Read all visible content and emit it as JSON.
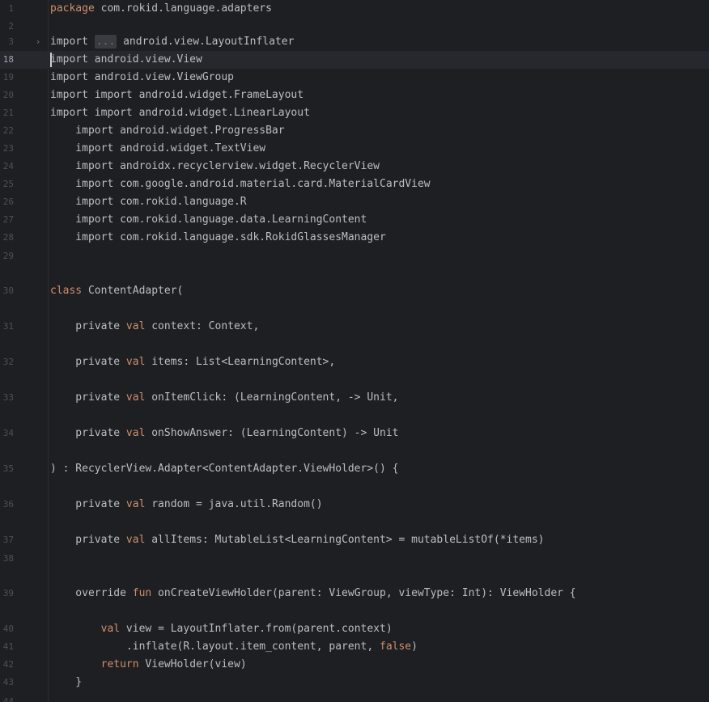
{
  "lines": [
    {
      "num": "1",
      "segments": [
        {
          "t": "package",
          "k": "kw"
        },
        {
          "t": " com.rokid.language.adapters",
          "k": "p"
        }
      ]
    },
    {
      "num": "2",
      "segments": []
    },
    {
      "num": "3",
      "segments": [
        {
          "t": "import ",
          "k": "p"
        },
        {
          "t": "...",
          "k": "fold"
        },
        {
          "t": " android.view.LayoutInflater",
          "k": "p"
        }
      ],
      "fold_icon": "chevron-right-icon"
    },
    {
      "num": "18",
      "segments": [
        {
          "t": "import android.view.View",
          "k": "p"
        }
      ],
      "current": true
    },
    {
      "num": "19",
      "segments": [
        {
          "t": "import android.view.ViewGroup",
          "k": "p"
        }
      ]
    },
    {
      "num": "20",
      "segments": [
        {
          "t": "import import android.widget.FrameLayout",
          "k": "p"
        }
      ]
    },
    {
      "num": "21",
      "segments": [
        {
          "t": "import import android.widget.LinearLayout",
          "k": "p"
        }
      ]
    },
    {
      "num": "22",
      "segments": [
        {
          "t": "    import android.widget.ProgressBar",
          "k": "p"
        }
      ]
    },
    {
      "num": "23",
      "segments": [
        {
          "t": "    import android.widget.TextView",
          "k": "p"
        }
      ]
    },
    {
      "num": "24",
      "segments": [
        {
          "t": "    import androidx.recyclerview.widget.RecyclerView",
          "k": "p"
        }
      ]
    },
    {
      "num": "25",
      "segments": [
        {
          "t": "    import com.google.android.material.card.MaterialCardView",
          "k": "p"
        }
      ]
    },
    {
      "num": "26",
      "segments": [
        {
          "t": "    import com.rokid.language.R",
          "k": "p"
        }
      ]
    },
    {
      "num": "27",
      "segments": [
        {
          "t": "    import com.rokid.language.data.LearningContent",
          "k": "p"
        }
      ]
    },
    {
      "num": "28",
      "segments": [
        {
          "t": "    import com.rokid.language.sdk.RokidGlassesManager",
          "k": "p"
        }
      ]
    },
    {
      "num": "29",
      "segments": []
    },
    {
      "num": "30",
      "segments": [
        {
          "t": "class",
          "k": "kw"
        },
        {
          "t": " ContentAdapter(",
          "k": "p"
        }
      ]
    },
    {
      "num": "31",
      "segments": [
        {
          "t": "    private ",
          "k": "p"
        },
        {
          "t": "val",
          "k": "kw"
        },
        {
          "t": " context: Context,",
          "k": "p"
        }
      ]
    },
    {
      "num": "32",
      "segments": [
        {
          "t": "    private ",
          "k": "p"
        },
        {
          "t": "val",
          "k": "kw"
        },
        {
          "t": " items: List<LearningContent>,",
          "k": "p"
        }
      ]
    },
    {
      "num": "33",
      "segments": [
        {
          "t": "    private ",
          "k": "p"
        },
        {
          "t": "val",
          "k": "kw"
        },
        {
          "t": " onItemClick: (LearningContent, -> Unit,",
          "k": "p"
        }
      ]
    },
    {
      "num": "34",
      "segments": [
        {
          "t": "    private ",
          "k": "p"
        },
        {
          "t": "val",
          "k": "kw"
        },
        {
          "t": " onShowAnswer: (LearningContent) -> Unit",
          "k": "p"
        }
      ]
    },
    {
      "num": "35",
      "segments": [
        {
          "t": ") : RecyclerView.Adapter<ContentAdapter.ViewHolder>() {",
          "k": "p"
        }
      ]
    },
    {
      "num": "36",
      "segments": [
        {
          "t": "    private ",
          "k": "p"
        },
        {
          "t": "val",
          "k": "kw"
        },
        {
          "t": " random = java.util.Random()",
          "k": "p"
        }
      ]
    },
    {
      "num": "37",
      "segments": [
        {
          "t": "    private ",
          "k": "p"
        },
        {
          "t": "val",
          "k": "kw"
        },
        {
          "t": " allItems: MutableList<LearningContent> = mutableListOf(*items)",
          "k": "p"
        }
      ]
    },
    {
      "num": "38",
      "segments": []
    },
    {
      "num": "39",
      "segments": [
        {
          "t": "    override ",
          "k": "p"
        },
        {
          "t": "fun",
          "k": "kw"
        },
        {
          "t": " onCreateViewHolder(parent: ViewGroup, viewType: Int): ViewHolder {",
          "k": "p"
        }
      ]
    },
    {
      "num": "40",
      "segments": [
        {
          "t": "        ",
          "k": "p"
        },
        {
          "t": "val",
          "k": "kw"
        },
        {
          "t": " view = LayoutInflater.from(parent.context)",
          "k": "p"
        }
      ]
    },
    {
      "num": "41",
      "segments": [
        {
          "t": "            .inflate(R.layout.item_content, parent, ",
          "k": "p"
        },
        {
          "t": "false",
          "k": "kw"
        },
        {
          "t": ")",
          "k": "p"
        }
      ]
    },
    {
      "num": "42",
      "segments": [
        {
          "t": "        ",
          "k": "p"
        },
        {
          "t": "return",
          "k": "kw"
        },
        {
          "t": " ViewHolder(view)",
          "k": "p"
        }
      ]
    },
    {
      "num": "43",
      "segments": [
        {
          "t": "    }",
          "k": "p"
        }
      ]
    },
    {
      "num": "44",
      "segments": []
    }
  ],
  "colors": {
    "background": "#1e1f22",
    "text": "#bcbec4",
    "keyword": "#cf8e6d",
    "line_number": "#4b5059",
    "current_line": "#26282e"
  }
}
